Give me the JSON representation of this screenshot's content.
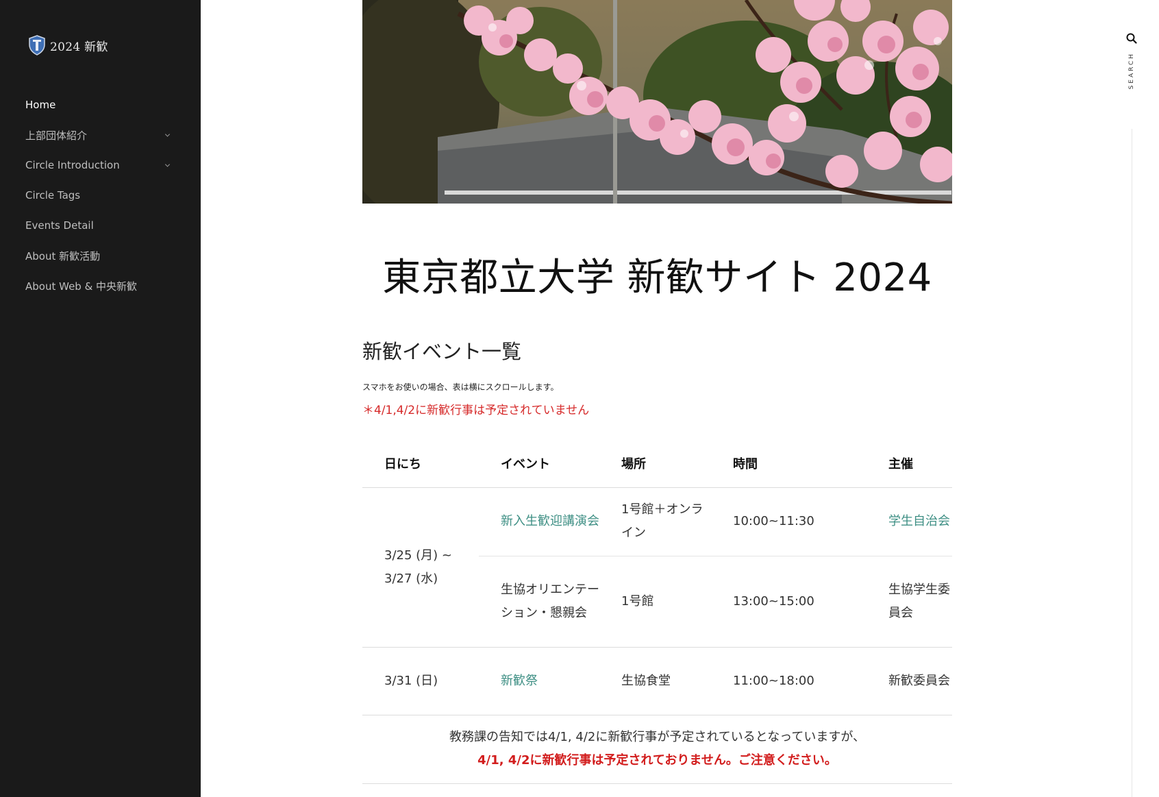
{
  "sidebar": {
    "logo_text": "2024 新歓",
    "nav": [
      {
        "label": "Home",
        "active": true,
        "has_children": false
      },
      {
        "label": "上部団体紹介",
        "active": false,
        "has_children": true
      },
      {
        "label": "Circle Introduction",
        "active": false,
        "has_children": true
      },
      {
        "label": "Circle Tags",
        "active": false,
        "has_children": false
      },
      {
        "label": "Events Detail",
        "active": false,
        "has_children": false
      },
      {
        "label": "About 新歓活動",
        "active": false,
        "has_children": false
      },
      {
        "label": "About Web & 中央新歓",
        "active": false,
        "has_children": false
      }
    ]
  },
  "search": {
    "label": "SEARCH",
    "icon": "search-icon"
  },
  "main": {
    "site_title": "東京都立大学 新歓サイト 2024",
    "section_heading": "新歓イベント一覧",
    "scroll_note": "スマホをお使いの場合、表は横にスクロールします。",
    "red_note": "＊4/1,4/2に新歓行事は予定されていません",
    "table": {
      "headers": {
        "date": "日にち",
        "event": "イベント",
        "place": "場所",
        "time": "時間",
        "organizer": "主催"
      },
      "rows": [
        {
          "date": "3/25 (月) ~ 3/27 (水)",
          "event": "新入生歓迎講演会",
          "event_link": true,
          "place": "1号館＋オンライン",
          "time": "10:00~11:30",
          "organizer": "学生自治会",
          "organizer_link": true
        },
        {
          "event": "生協オリエンテーション・懇親会",
          "event_link": false,
          "place": "1号館",
          "time": "13:00~15:00",
          "organizer": "生協学生委員会",
          "organizer_link": false
        },
        {
          "date": "3/31 (日)",
          "event": "新歓祭",
          "event_link": true,
          "place": "生協食堂",
          "time": "11:00~18:00",
          "organizer": "新歓委員会",
          "organizer_link": false
        }
      ],
      "notice_line1": "教務課の告知では4/1, 4/2に新歓行事が予定されているとなっていますが、",
      "notice_line2": "4/1, 4/2に新歓行事は予定されておりません。ご注意ください。"
    }
  },
  "colors": {
    "sidebar_bg": "#1a1a1a",
    "link": "#3e8f84",
    "alert_red": "#d62a2a"
  }
}
